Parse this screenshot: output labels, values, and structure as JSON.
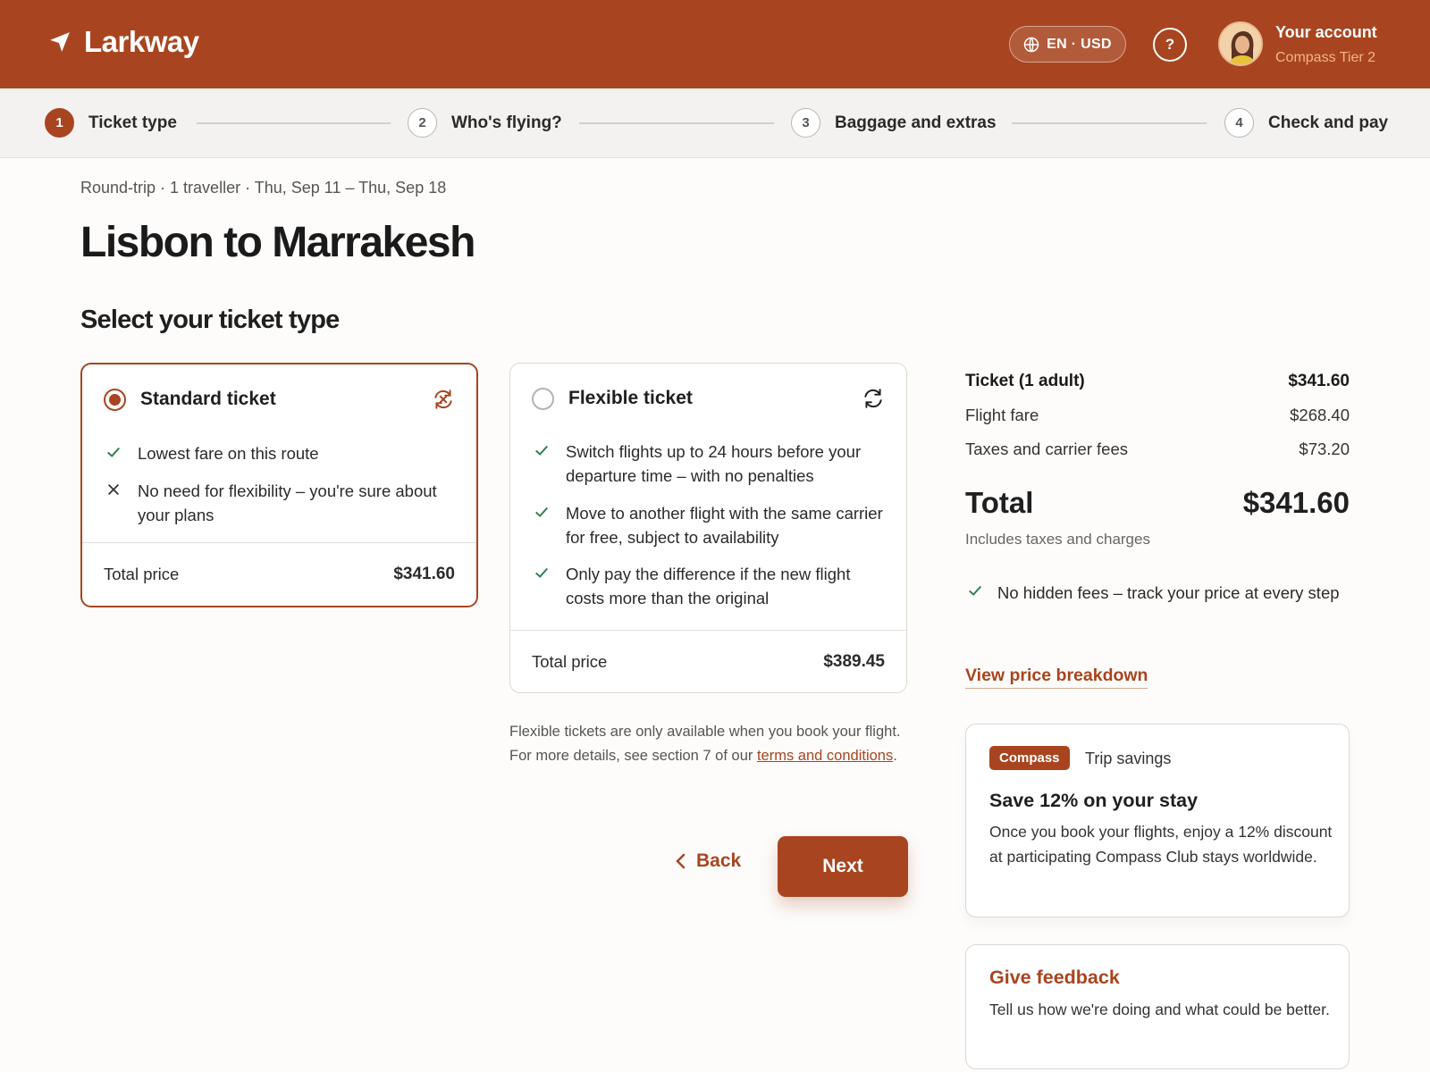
{
  "header": {
    "brand": "Larkway",
    "locale_button": "EN · USD",
    "help_label": "?",
    "account_name": "Your account",
    "account_tier": "Compass Tier 2"
  },
  "steps": [
    {
      "num": "1",
      "label": "Ticket type",
      "active": true
    },
    {
      "num": "2",
      "label": "Who's flying?",
      "active": false
    },
    {
      "num": "3",
      "label": "Baggage and extras",
      "active": false
    },
    {
      "num": "4",
      "label": "Check and pay",
      "active": false
    }
  ],
  "trip": {
    "summary": "Round-trip · 1 traveller · Thu, Sep 11 – Thu, Sep 18",
    "title": "Lisbon to Marrakesh",
    "section_title": "Select your ticket type"
  },
  "tickets": [
    {
      "title": "Standard ticket",
      "selected": true,
      "features": [
        {
          "ok": true,
          "text": "Lowest fare on this route"
        },
        {
          "ok": false,
          "text": "No need for flexibility – you're sure about your plans"
        }
      ],
      "total_label": "Total price",
      "total_price": "$341.60"
    },
    {
      "title": "Flexible ticket",
      "selected": false,
      "features": [
        {
          "ok": true,
          "text": "Switch flights up to 24 hours before your departure time – with no penalties"
        },
        {
          "ok": true,
          "text": "Move to another flight with the same carrier for free, subject to availability"
        },
        {
          "ok": true,
          "text": "Only pay the difference if the new flight costs more than the original"
        }
      ],
      "total_label": "Total price",
      "total_price": "$389.45"
    }
  ],
  "note": {
    "text": "Flexible tickets are only available when you book your flight. For more details, see section 7 of our ",
    "link": "terms and conditions",
    "end": "."
  },
  "actions": {
    "back": "Back",
    "next": "Next"
  },
  "summary": {
    "ticket_label": "Ticket (1 adult)",
    "ticket_value": "$341.60",
    "fare_label": "Flight fare",
    "fare_value": "$268.40",
    "taxes_label": "Taxes and carrier fees",
    "taxes_value": "$73.20",
    "total_label": "Total",
    "total_value": "$341.60",
    "total_note": "Includes taxes and charges",
    "guarantee": "No hidden fees – track your price at every step",
    "breakdown_link": "View price breakdown"
  },
  "promo": {
    "badge": "Compass",
    "tag": "Trip savings",
    "title": "Save 12% on your stay",
    "text": "Once you book your flights, enjoy a 12% discount at participating Compass Club stays worldwide."
  },
  "feedback": {
    "title": "Give feedback",
    "text": "Tell us how we're doing and what could be better."
  },
  "colors": {
    "accent": "#a84520",
    "check": "#2e7d4f"
  }
}
